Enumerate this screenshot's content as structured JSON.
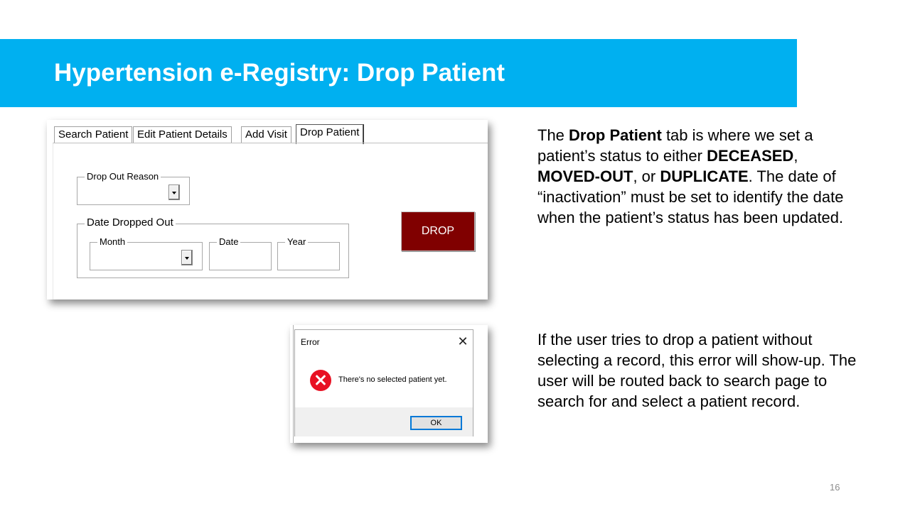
{
  "slide": {
    "title": "Hypertension e-Registry: Drop Patient",
    "page_number": "16"
  },
  "form": {
    "tabs": [
      "Search Patient",
      "Edit Patient Details",
      "Add Visit",
      "Drop Patient"
    ],
    "active_tab": "Drop Patient",
    "drop_out_reason_label": "Drop Out Reason",
    "drop_out_reason_value": "",
    "date_dropped_out_label": "Date Dropped Out",
    "month_label": "Month",
    "month_value": "",
    "date_label": "Date",
    "date_value": "",
    "year_label": "Year",
    "year_value": "",
    "drop_button_label": "DROP"
  },
  "error_dialog": {
    "title": "Error",
    "message": "There's no selected patient yet.",
    "ok_label": "OK",
    "icon": "error-icon"
  },
  "description": {
    "p1": {
      "t1": "The ",
      "b1": "Drop Patient",
      "t2": " tab is where we set a patient’s status to either ",
      "b2": "DECEASED",
      "t3": ", ",
      "b3": "MOVED-OUT",
      "t4": ", or ",
      "b4": "DUPLICATE",
      "t5": ". The date of “inactivation” must be set to identify the date when the patient’s status has been updated."
    },
    "p2": "If the user tries to drop a patient without selecting a record, this error will show-up. The user will be routed back to search page to search for and select a patient record."
  },
  "colors": {
    "title_bar": "#00b0f0",
    "drop_button": "#800000",
    "error_icon": "#e81123",
    "ok_border": "#0078d7"
  }
}
